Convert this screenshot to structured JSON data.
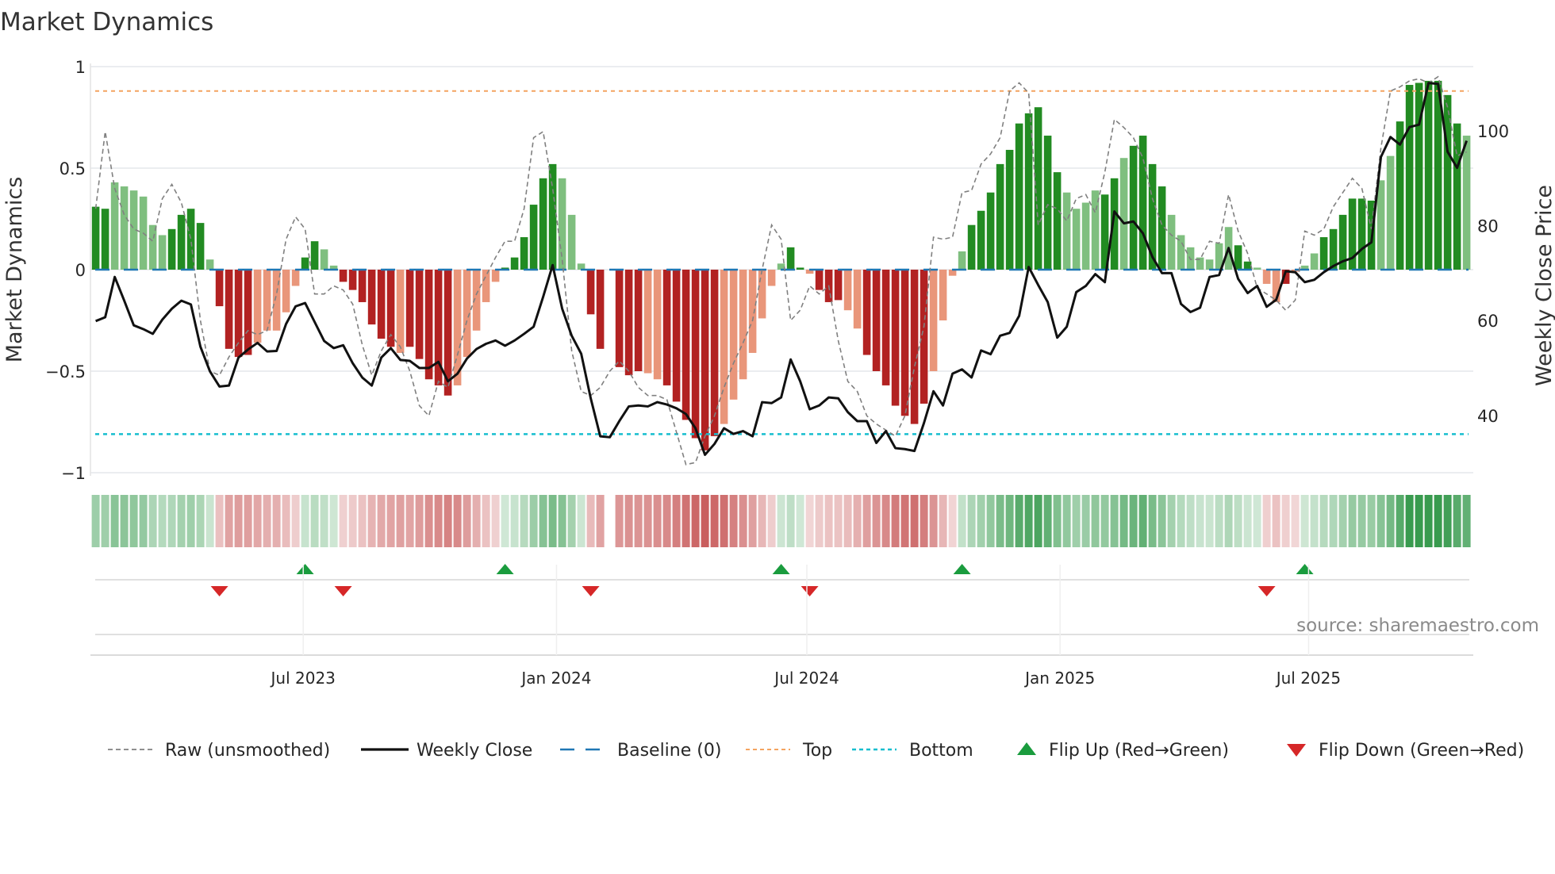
{
  "chart_data": {
    "type": "bar",
    "title": "Market Dynamics",
    "ylabel": "Market Dynamics",
    "y2label": "Weekly Close Price",
    "ylim": [
      -1,
      1
    ],
    "y2lim": [
      27,
      113
    ],
    "yticks": [
      {
        "v": 1,
        "label": "1"
      },
      {
        "v": 0.5,
        "label": "0.5"
      },
      {
        "v": 0,
        "label": "0"
      },
      {
        "v": -0.5,
        "label": "−0.5"
      },
      {
        "v": -1,
        "label": "−1"
      }
    ],
    "y2ticks": [
      {
        "v": 100,
        "label": "100"
      },
      {
        "v": 80,
        "label": "80"
      },
      {
        "v": 60,
        "label": "60"
      },
      {
        "v": 40,
        "label": "40"
      }
    ],
    "x_unit": "week index",
    "xticks": [
      {
        "v": 21.8,
        "label": "Jul 2023"
      },
      {
        "v": 48.4,
        "label": "Jan 2024"
      },
      {
        "v": 74.7,
        "label": "Jul 2024"
      },
      {
        "v": 101.3,
        "label": "Jan 2025"
      },
      {
        "v": 127.4,
        "label": "Jul 2025"
      }
    ],
    "top_level": 0.88,
    "bottom_level": -0.81,
    "baseline": 0,
    "bars": [
      0.31,
      0.3,
      0.43,
      0.41,
      0.39,
      0.36,
      0.22,
      0.17,
      0.2,
      0.27,
      0.3,
      0.23,
      0.05,
      -0.18,
      -0.39,
      -0.43,
      -0.42,
      -0.36,
      -0.3,
      -0.3,
      -0.21,
      -0.08,
      0.06,
      0.14,
      0.1,
      0.02,
      -0.06,
      -0.1,
      -0.16,
      -0.27,
      -0.34,
      -0.38,
      -0.41,
      -0.38,
      -0.44,
      -0.54,
      -0.57,
      -0.62,
      -0.57,
      -0.43,
      -0.3,
      -0.16,
      -0.06,
      0.01,
      0.06,
      0.16,
      0.32,
      0.45,
      0.52,
      0.45,
      0.27,
      0.03,
      -0.22,
      -0.39,
      null,
      -0.48,
      -0.52,
      -0.5,
      -0.51,
      -0.54,
      -0.57,
      -0.65,
      -0.74,
      -0.83,
      -0.89,
      -0.82,
      -0.76,
      -0.64,
      -0.54,
      -0.41,
      -0.24,
      -0.08,
      0.03,
      0.11,
      0.01,
      -0.02,
      -0.1,
      -0.16,
      -0.15,
      -0.2,
      -0.29,
      -0.42,
      -0.5,
      -0.57,
      -0.67,
      -0.72,
      -0.76,
      -0.66,
      -0.5,
      -0.25,
      -0.03,
      0.09,
      0.22,
      0.29,
      0.38,
      0.52,
      0.59,
      0.72,
      0.77,
      0.8,
      0.66,
      0.48,
      0.38,
      0.3,
      0.33,
      0.39,
      0.37,
      0.45,
      0.55,
      0.61,
      0.66,
      0.52,
      0.41,
      0.27,
      0.17,
      0.11,
      0.06,
      0.05,
      0.13,
      0.21,
      0.12,
      0.04,
      0.01,
      -0.07,
      -0.16,
      -0.07,
      -0.01,
      0.02,
      0.08,
      0.16,
      0.2,
      0.27,
      0.35,
      0.35,
      0.34,
      0.44,
      0.56,
      0.73,
      0.91,
      0.92,
      0.93,
      0.93,
      0.86,
      0.72,
      0.66
    ],
    "bar_strength": "sswwwwwwsssswsssswwwwwsswwsssssswssssswwwwwsssssswwwsssssswwsssssswwwwwwwsswssswwssssssswwwwsssssssssswwwwsswsssswwwwwwwsswwwswwwsssssswwssssssswww",
    "raw": [
      0.3,
      0.68,
      0.4,
      0.27,
      0.2,
      0.18,
      0.14,
      0.35,
      0.42,
      0.33,
      0.15,
      -0.25,
      -0.5,
      -0.52,
      -0.43,
      -0.36,
      -0.3,
      -0.32,
      -0.3,
      -0.12,
      0.15,
      0.26,
      0.2,
      -0.12,
      -0.12,
      -0.08,
      -0.1,
      -0.17,
      -0.37,
      -0.52,
      -0.4,
      -0.32,
      -0.38,
      -0.5,
      -0.67,
      -0.72,
      -0.55,
      -0.58,
      -0.42,
      -0.25,
      -0.12,
      -0.03,
      0.06,
      0.14,
      0.14,
      0.3,
      0.65,
      0.68,
      0.4,
      0.05,
      -0.4,
      -0.6,
      -0.62,
      -0.58,
      -0.5,
      -0.45,
      -0.5,
      -0.58,
      -0.62,
      -0.62,
      -0.64,
      -0.8,
      -0.96,
      -0.95,
      -0.82,
      -0.72,
      -0.58,
      -0.46,
      -0.36,
      -0.25,
      0.0,
      0.22,
      0.15,
      -0.25,
      -0.2,
      -0.08,
      -0.12,
      -0.08,
      -0.35,
      -0.55,
      -0.6,
      -0.72,
      -0.76,
      -0.79,
      -0.82,
      -0.72,
      -0.48,
      -0.28,
      0.16,
      0.15,
      0.16,
      0.38,
      0.39,
      0.52,
      0.57,
      0.65,
      0.88,
      0.92,
      0.87,
      0.22,
      0.32,
      0.3,
      0.24,
      0.35,
      0.37,
      0.28,
      0.48,
      0.74,
      0.7,
      0.65,
      0.55,
      0.35,
      0.22,
      0.17,
      0.14,
      0.05,
      0.05,
      0.14,
      0.13,
      0.37,
      0.19,
      0.08,
      -0.09,
      -0.12,
      -0.15,
      -0.2,
      -0.15,
      0.19,
      0.17,
      0.2,
      0.31,
      0.38,
      0.45,
      0.4,
      0.2,
      0.6,
      0.88,
      0.9,
      0.93,
      0.94,
      0.92,
      0.95,
      0.8,
      0.56,
      0.58
    ],
    "weekly_close": [
      59.9,
      60.7,
      69.2,
      64.2,
      59.0,
      58.2,
      57.2,
      60.2,
      62.5,
      64.2,
      63.4,
      54.5,
      49.3,
      46.1,
      46.3,
      52.2,
      53.9,
      55.3,
      53.5,
      53.6,
      59.3,
      63.0,
      63.7,
      59.7,
      55.7,
      54.2,
      54.8,
      51.0,
      48.0,
      46.3,
      52.2,
      54.2,
      51.7,
      51.5,
      50.0,
      50.0,
      51.3,
      47.2,
      48.8,
      52.0,
      54.0,
      55.1,
      55.8,
      54.7,
      55.8,
      57.2,
      58.7,
      65.0,
      71.7,
      62.5,
      56.8,
      53.0,
      43.6,
      35.6,
      35.4,
      38.8,
      41.9,
      42.1,
      41.9,
      42.8,
      42.3,
      41.5,
      40.3,
      37.3,
      31.7,
      34.0,
      37.3,
      36.1,
      36.7,
      35.6,
      42.8,
      42.6,
      43.8,
      51.8,
      47.2,
      41.3,
      42.1,
      43.8,
      43.6,
      40.7,
      38.8,
      38.8,
      34.2,
      36.7,
      33.1,
      32.9,
      32.5,
      38.4,
      45.1,
      42.1,
      48.8,
      49.7,
      48.0,
      53.7,
      52.9,
      56.8,
      57.4,
      61.0,
      71.3,
      67.5,
      63.9,
      56.4,
      58.7,
      66.0,
      67.3,
      69.8,
      68.1,
      83.0,
      80.5,
      80.9,
      78.4,
      73.4,
      70.0,
      70.0,
      63.5,
      61.8,
      62.7,
      69.2,
      69.6,
      75.3,
      68.8,
      65.8,
      67.3,
      62.9,
      64.4,
      70.4,
      70.2,
      68.1,
      68.6,
      70.2,
      71.5,
      72.5,
      73.2,
      75.1,
      76.5,
      94.5,
      98.7,
      97.1,
      100.8,
      101.3,
      110.1,
      109.9,
      95.6,
      92.2,
      97.9
    ],
    "flip_up": [
      22,
      43,
      72,
      91,
      127
    ],
    "flip_down": [
      13,
      26,
      52,
      75,
      123
    ],
    "legend": [
      {
        "label": "Raw (unsmoothed)",
        "kind": "raw"
      },
      {
        "label": "Weekly Close",
        "kind": "close"
      },
      {
        "label": "Baseline (0)",
        "kind": "baseline"
      },
      {
        "label": "Top",
        "kind": "top"
      },
      {
        "label": "Bottom",
        "kind": "bottom"
      },
      {
        "label": "Flip Up (Red→Green)",
        "kind": "up"
      },
      {
        "label": "Flip Down (Green→Red)",
        "kind": "down"
      }
    ],
    "legend_position": "bottom",
    "source": "source: sharemaestro.com",
    "colors": {
      "strong_pos": "#228b22",
      "weak_pos": "#7fbf7f",
      "strong_neg": "#b22222",
      "weak_neg": "#e9967a",
      "raw": "#808080",
      "close": "#111111",
      "baseline": "#1f77b4",
      "top": "#f4a460",
      "bottom": "#17becf",
      "flip_up": "#1a9c3e",
      "flip_down": "#d62728"
    }
  }
}
